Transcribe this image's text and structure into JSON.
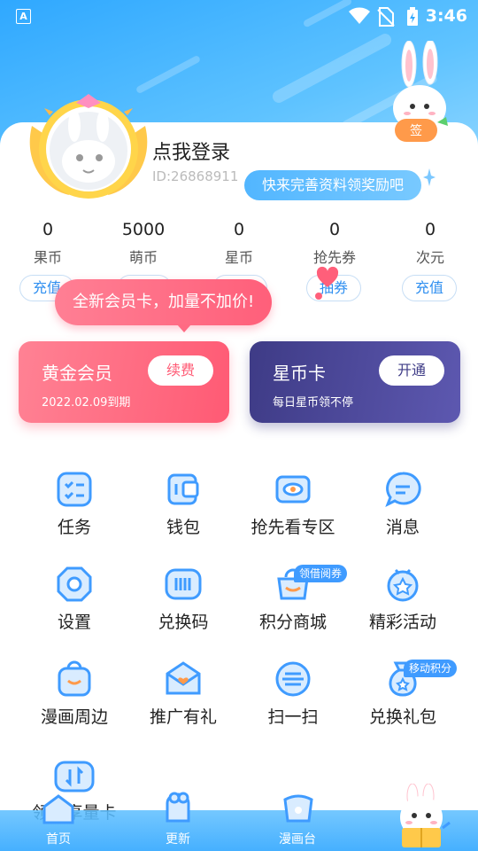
{
  "status_bar": {
    "time": "3:46",
    "app_badge": "A"
  },
  "profile": {
    "name": "点我登录",
    "id": "ID:26868911",
    "tip": "快来完善资料领奖励吧"
  },
  "stats": [
    {
      "value": "0",
      "label": "果币",
      "action": "充值"
    },
    {
      "value": "5000",
      "label": "萌币",
      "action": ""
    },
    {
      "value": "0",
      "label": "星币",
      "action": ""
    },
    {
      "value": "0",
      "label": "抢先券",
      "action": "抽券"
    },
    {
      "value": "0",
      "label": "次元",
      "action": "充值"
    }
  ],
  "promo_tip": "全新会员卡，加量不加价!",
  "cards": {
    "gold": {
      "title": "黄金会员",
      "subtitle": "2022.02.09到期",
      "button": "续费"
    },
    "star": {
      "title": "星币卡",
      "subtitle": "每日星币领不停",
      "button": "开通"
    }
  },
  "grid": [
    {
      "label": "任务",
      "icon": "task-icon"
    },
    {
      "label": "钱包",
      "icon": "wallet-icon"
    },
    {
      "label": "抢先看专区",
      "icon": "preview-icon"
    },
    {
      "label": "消息",
      "icon": "message-icon"
    },
    {
      "label": "设置",
      "icon": "settings-icon"
    },
    {
      "label": "兑换码",
      "icon": "redeem-code-icon"
    },
    {
      "label": "积分商城",
      "icon": "points-mall-icon",
      "badge": "领借阅券"
    },
    {
      "label": "精彩活动",
      "icon": "activity-icon"
    },
    {
      "label": "漫画周边",
      "icon": "merch-icon"
    },
    {
      "label": "推广有礼",
      "icon": "invite-icon"
    },
    {
      "label": "扫一扫",
      "icon": "scan-icon"
    },
    {
      "label": "兑换礼包",
      "icon": "gift-pack-icon",
      "badge": "移动积分"
    },
    {
      "label": "领…享量卡",
      "icon": "data-card-icon"
    }
  ],
  "tabs": [
    {
      "label": "首页",
      "icon": "home-icon"
    },
    {
      "label": "更新",
      "icon": "update-icon"
    },
    {
      "label": "漫画台",
      "icon": "comic-icon"
    }
  ],
  "colors": {
    "primary": "#3f9bff",
    "pink": "#ff5f7a",
    "indigo": "#3e3b86"
  }
}
